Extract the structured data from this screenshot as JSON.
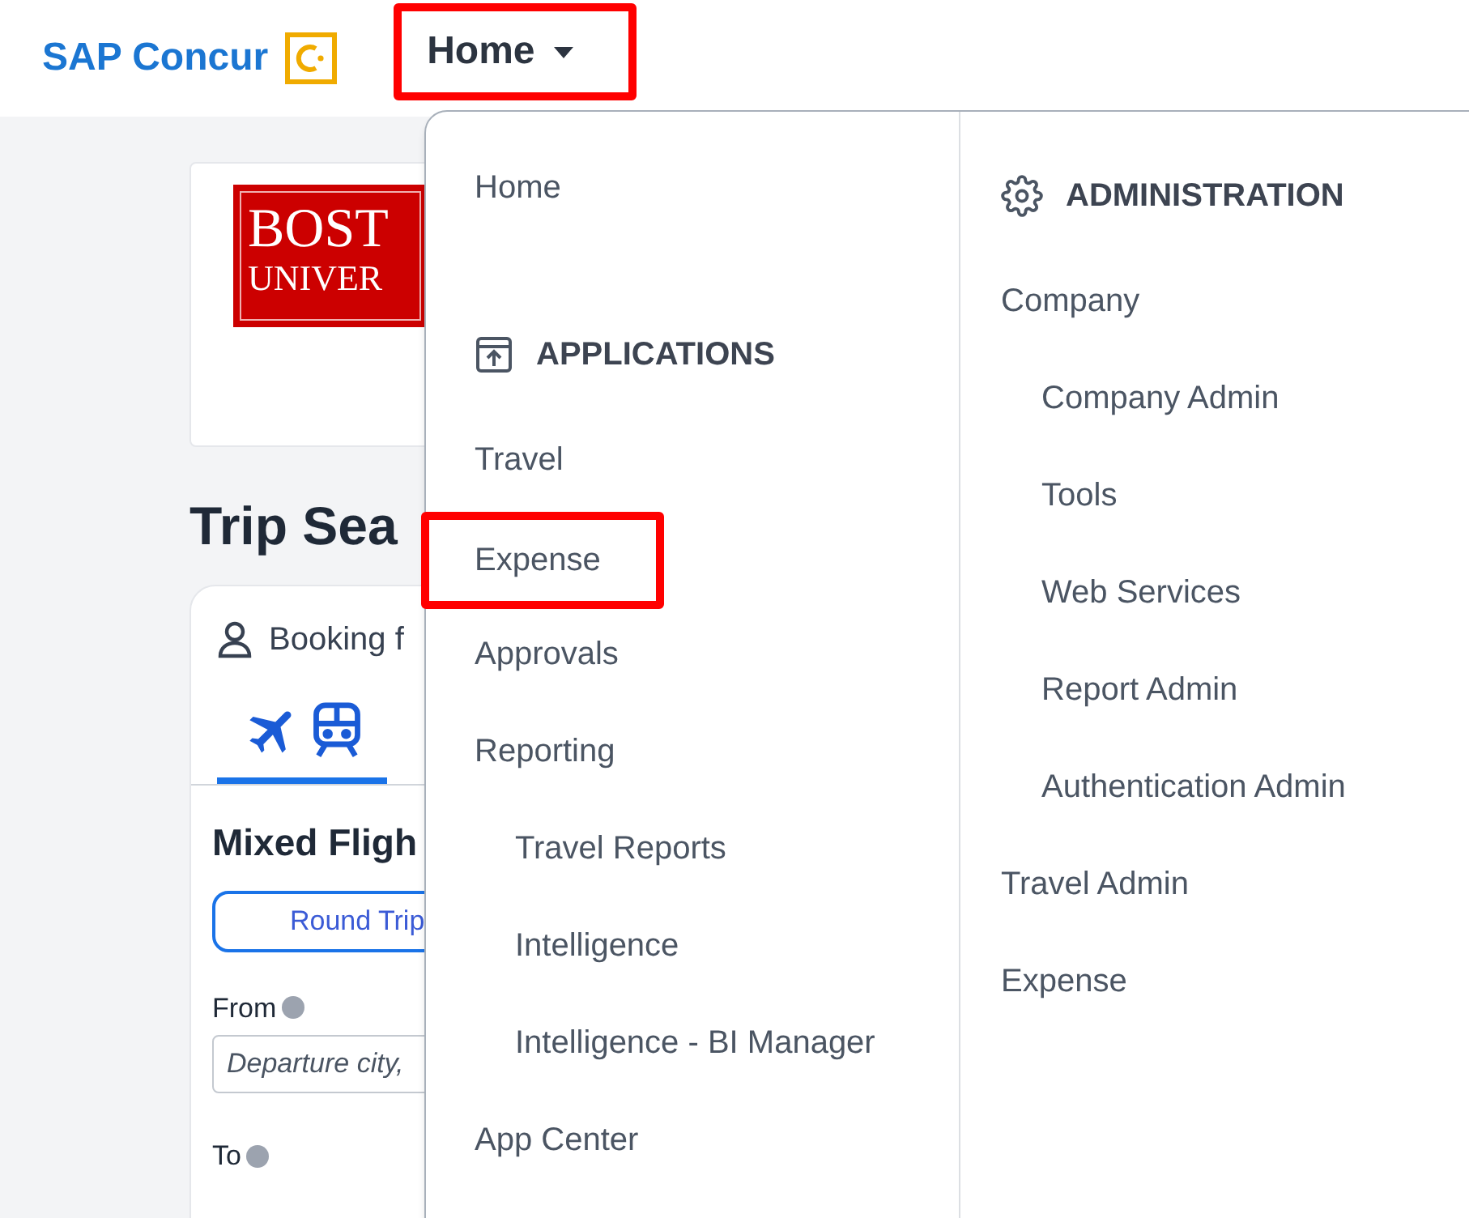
{
  "header": {
    "brand": "SAP Concur",
    "nav": {
      "label": "Home",
      "highlighted": true
    }
  },
  "background_page": {
    "logo_lines": [
      "BOST",
      "UNIVER"
    ],
    "title": "Trip Sea",
    "booking_label": "Booking f",
    "section_title": "Mixed Fligh",
    "trip_button": "Round Trip",
    "from_label": "From",
    "from_placeholder": "Departure city,",
    "to_label": "To"
  },
  "menu": {
    "left": [
      {
        "kind": "item",
        "label": "Home",
        "highlighted": false
      },
      {
        "kind": "header",
        "label": "APPLICATIONS"
      },
      {
        "kind": "item",
        "label": "Travel",
        "highlighted": false
      },
      {
        "kind": "item",
        "label": "Expense",
        "highlighted": true
      },
      {
        "kind": "item",
        "label": "Approvals",
        "highlighted": false
      },
      {
        "kind": "item",
        "label": "Reporting",
        "highlighted": false,
        "children": [
          {
            "label": "Travel Reports"
          },
          {
            "label": "Intelligence"
          },
          {
            "label": "Intelligence - BI Manager"
          }
        ]
      },
      {
        "kind": "item",
        "label": "App Center",
        "highlighted": false
      }
    ],
    "right": [
      {
        "kind": "header",
        "label": "ADMINISTRATION"
      },
      {
        "kind": "item",
        "label": "Company",
        "highlighted": false,
        "children": [
          {
            "label": "Company Admin"
          },
          {
            "label": "Tools"
          },
          {
            "label": "Web Services"
          },
          {
            "label": "Report Admin"
          },
          {
            "label": "Authentication Admin"
          }
        ]
      },
      {
        "kind": "item",
        "label": "Travel Admin",
        "highlighted": false
      },
      {
        "kind": "item",
        "label": "Expense",
        "highlighted": false
      }
    ]
  }
}
